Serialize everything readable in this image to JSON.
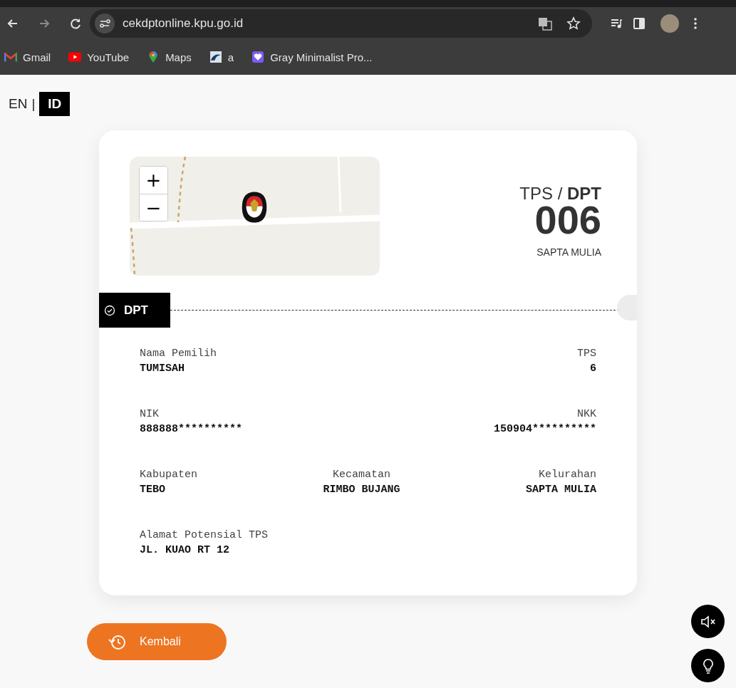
{
  "browser": {
    "url": "cekdptonline.kpu.go.id",
    "bookmarks": [
      {
        "label": "Gmail",
        "kind": "mail"
      },
      {
        "label": "YouTube",
        "kind": "video"
      },
      {
        "label": "Maps",
        "kind": "pin"
      },
      {
        "label": "a",
        "kind": "bird"
      },
      {
        "label": "Gray Minimalist Pro...",
        "kind": "heart"
      }
    ]
  },
  "language": {
    "options": [
      {
        "label": "EN",
        "selected": false
      },
      {
        "label": "ID",
        "selected": true
      }
    ],
    "separator": "|"
  },
  "map": {
    "zoom_in": "+",
    "zoom_out": "−"
  },
  "tps": {
    "heading": "TPS / **DPT**",
    "number": "006",
    "village": "SAPTA MULIA"
  },
  "badge": "DPT",
  "field_rows": [
    {
      "fields": [
        {
          "label": "Nama Pemilih",
          "value": "TUMISAH"
        },
        {
          "label": "TPS",
          "value": "6"
        }
      ]
    },
    {
      "fields": [
        {
          "label": "NIK",
          "value": "888888**********"
        },
        {
          "label": "NKK",
          "value": "150904**********"
        }
      ]
    },
    {
      "fields": [
        {
          "label": "Kabupaten",
          "value": "TEBO"
        },
        {
          "label": "Kecamatan",
          "value": "RIMBO BUJANG"
        },
        {
          "label": "Kelurahan",
          "value": "SAPTA MULIA"
        }
      ]
    },
    {
      "fields": [
        {
          "label": "Alamat Potensial TPS",
          "value": "JL. KUAO RT 12"
        }
      ]
    }
  ],
  "back_button": "Kembali"
}
